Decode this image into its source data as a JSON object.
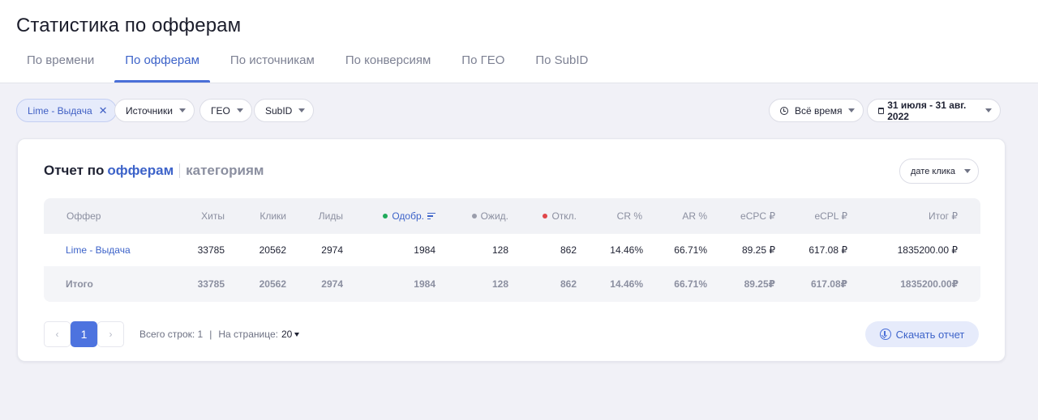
{
  "page": {
    "title": "Статистика по офферам"
  },
  "tabs": [
    {
      "label": "По времени"
    },
    {
      "label": "По офферам",
      "active": true
    },
    {
      "label": "По источникам"
    },
    {
      "label": "По конверсиям"
    },
    {
      "label": "По ГЕО"
    },
    {
      "label": "По SubID"
    }
  ],
  "filters": {
    "chip": {
      "label": "Lime - Выдача",
      "remove_icon": "close-icon"
    },
    "sources": "Источники",
    "geo": "ГЕО",
    "subid": "SubID",
    "time_range": "Всё время",
    "date_range": "31 июля - 31 авг. 2022"
  },
  "report": {
    "prefix": "Отчет по",
    "active_mode": "офферам",
    "other_mode": "категориям",
    "date_type": "дате клика"
  },
  "table": {
    "headers": {
      "offer": "Оффер",
      "hits": "Хиты",
      "clicks": "Клики",
      "leads": "Лиды",
      "approved": "Одобр.",
      "pending": "Ожид.",
      "rejected": "Откл.",
      "cr": "CR %",
      "ar": "AR %",
      "ecpc": "eCPC ₽",
      "ecpl": "eCPL ₽",
      "total": "Итог ₽"
    },
    "status_colors": {
      "approved": "#1faa5a",
      "pending": "#9a9dab",
      "rejected": "#e0464a"
    },
    "rows": [
      {
        "offer": "Lime - Выдача",
        "hits": "33785",
        "clicks": "20562",
        "leads": "2974",
        "approved": "1984",
        "pending": "128",
        "rejected": "862",
        "cr": "14.46%",
        "ar": "66.71%",
        "ecpc": "89.25 ₽",
        "ecpl": "617.08 ₽",
        "total": "1835200.00 ₽"
      }
    ],
    "totals": {
      "offer": "Итого",
      "hits": "33785",
      "clicks": "20562",
      "leads": "2974",
      "approved": "1984",
      "pending": "128",
      "rejected": "862",
      "cr": "14.46%",
      "ar": "66.71%",
      "ecpc": "89.25₽",
      "ecpl": "617.08₽",
      "total": "1835200.00₽"
    }
  },
  "pagination": {
    "current_page": "1",
    "total_rows_label": "Всего строк: 1",
    "separator": "|",
    "per_page_label": "На странице:",
    "per_page_value": "20"
  },
  "download": {
    "label": "Скачать отчет"
  },
  "colors": {
    "accent": "#4a6fd8",
    "background": "#f1f1f7"
  }
}
